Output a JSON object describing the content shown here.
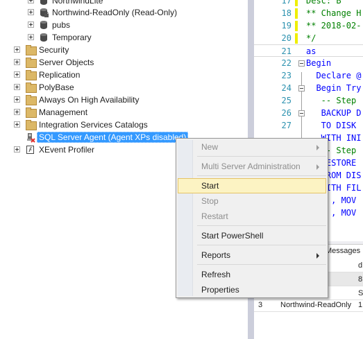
{
  "tree": {
    "items": [
      {
        "label": "NorthwindLite",
        "icon": "database-icon"
      },
      {
        "label": "Northwind-ReadOnly (Read-Only)",
        "icon": "database-readonly-icon"
      },
      {
        "label": "pubs",
        "icon": "database-icon"
      },
      {
        "label": "Temporary",
        "icon": "database-icon"
      },
      {
        "label": "Security",
        "icon": "folder-icon"
      },
      {
        "label": "Server Objects",
        "icon": "folder-icon"
      },
      {
        "label": "Replication",
        "icon": "folder-icon"
      },
      {
        "label": "PolyBase",
        "icon": "folder-icon"
      },
      {
        "label": "Always On High Availability",
        "icon": "folder-icon"
      },
      {
        "label": "Management",
        "icon": "folder-icon"
      },
      {
        "label": "Integration Services Catalogs",
        "icon": "folder-icon"
      },
      {
        "label": "SQL Server Agent (Agent XPs disabled)",
        "icon": "sql-agent-disabled-icon",
        "selected": true
      },
      {
        "label": "XEvent Profiler",
        "icon": "xevent-profiler-icon"
      }
    ]
  },
  "editor": {
    "lines": [
      {
        "num": "17",
        "text": "Desc: B",
        "color": "#008000"
      },
      {
        "num": "18",
        "text": "** Change H",
        "color": "#008000"
      },
      {
        "num": "19",
        "text": "** 2018-02-",
        "color": "#008000"
      },
      {
        "num": "20",
        "text": "*/",
        "color": "#008000"
      },
      {
        "num": "21",
        "text": "as",
        "color": "#0000ff"
      },
      {
        "num": "22",
        "text": "Begin",
        "color": "#0000ff"
      },
      {
        "num": "23",
        "text": "  Declare @",
        "color": "#0000ff"
      },
      {
        "num": "24",
        "text": "  Begin Try",
        "color": "#0000ff"
      },
      {
        "num": "25",
        "text": "   -- Step",
        "color": "#008000"
      },
      {
        "num": "26",
        "text": "   BACKUP D",
        "color": "#0000ff"
      },
      {
        "num": "27",
        "text": "   TO DISK",
        "color": "#0000ff"
      },
      {
        "num": "",
        "text": "   WITH INI",
        "color": "#0000ff"
      },
      {
        "num": "",
        "text": "   -- Step",
        "color": "#008000"
      },
      {
        "num": "",
        "text": "   RESTORE",
        "color": "#0000ff"
      },
      {
        "num": "",
        "text": "   FROM DIS",
        "color": "#0000ff"
      },
      {
        "num": "",
        "text": "   WITH FIL",
        "color": "#0000ff"
      },
      {
        "num": "",
        "text": "     , MOV",
        "color": "#0000ff"
      },
      {
        "num": "",
        "text": "     , MOV",
        "color": "#0000ff"
      }
    ]
  },
  "results": {
    "tab_label": "Messages",
    "rows": [
      {
        "num": "",
        "name": "",
        "extra": "d"
      },
      {
        "num": "",
        "name": "",
        "extra": "8"
      },
      {
        "num": "",
        "name": "",
        "extra": "S"
      },
      {
        "num": "3",
        "name": "Northwind-ReadOnly",
        "extra": "1"
      }
    ]
  },
  "context_menu": {
    "items": [
      {
        "label": "New",
        "disabled": true,
        "submenu": true
      },
      {
        "separator": true
      },
      {
        "label": "Multi Server Administration",
        "disabled": true,
        "submenu": true
      },
      {
        "separator": true
      },
      {
        "label": "Start",
        "disabled": false,
        "hovered": true
      },
      {
        "label": "Stop",
        "disabled": true
      },
      {
        "label": "Restart",
        "disabled": true
      },
      {
        "separator": true
      },
      {
        "label": "Start PowerShell",
        "disabled": false
      },
      {
        "separator": true
      },
      {
        "label": "Reports",
        "disabled": false,
        "submenu": true
      },
      {
        "separator": true
      },
      {
        "label": "Refresh",
        "disabled": false
      },
      {
        "label": "Properties",
        "disabled": false
      }
    ]
  },
  "colors": {
    "selection": "#3399ff",
    "menu_hover": "#fcf3c3",
    "menu_hover_border": "#e5c365",
    "comment": "#008000",
    "keyword": "#0000ff",
    "line_number": "#2b91af",
    "change_marker": "#efef00"
  }
}
